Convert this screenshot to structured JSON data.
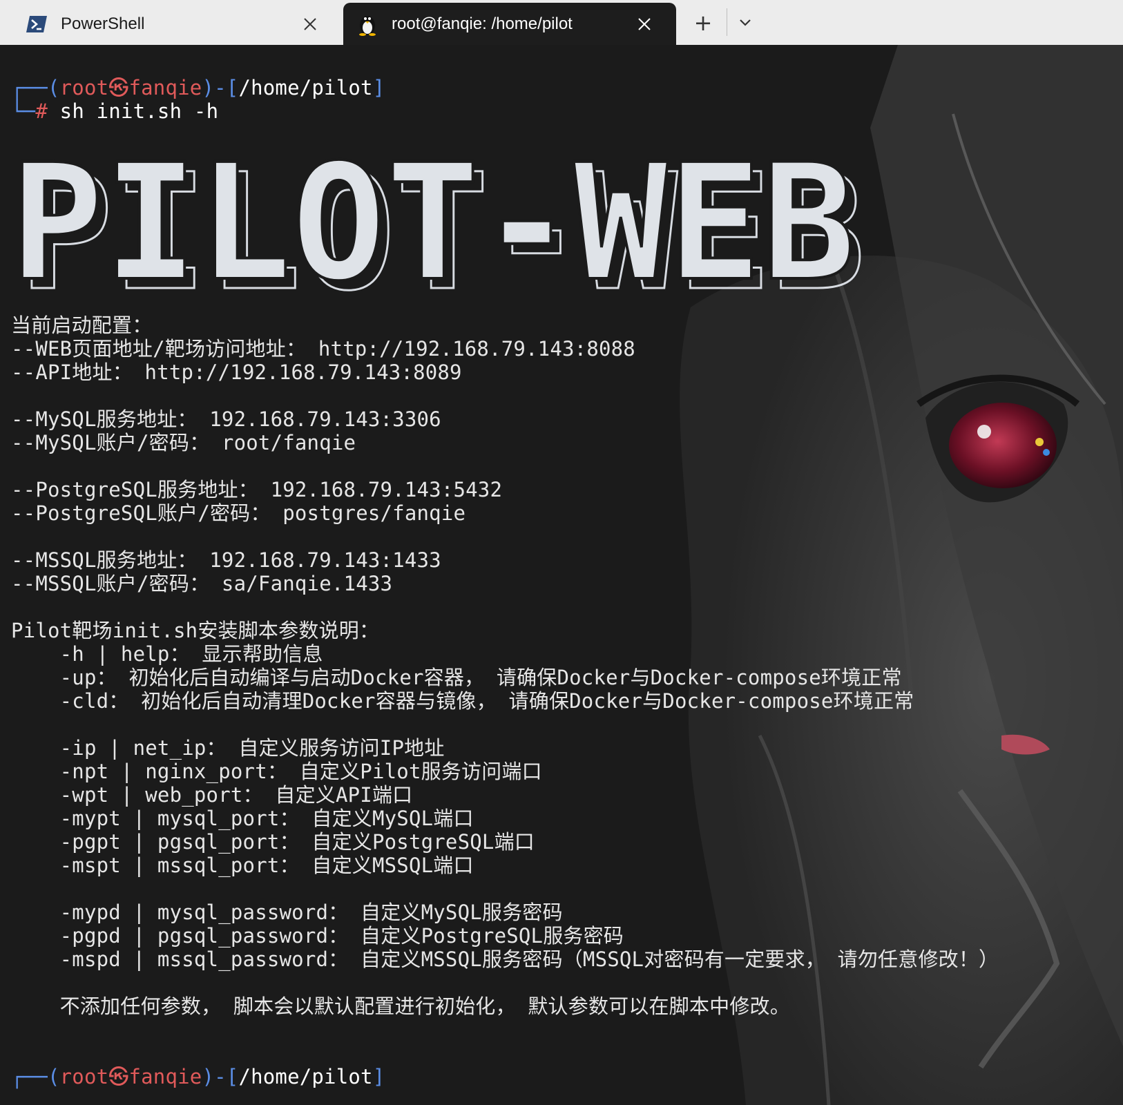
{
  "tabs": [
    {
      "label": "PowerShell",
      "icon": "powershell-icon",
      "active": false
    },
    {
      "label": "root@fanqie: /home/pilot",
      "icon": "linux-penguin-icon",
      "active": true
    }
  ],
  "tabbar": {
    "new_tab_label": "+",
    "dropdown_icon": "chevron-down-icon"
  },
  "prompt": {
    "open": "┌──(",
    "user": "root",
    "at_symbol": "㉿",
    "host": "fanqie",
    "mid": ")-[",
    "path": "/home/pilot",
    "close": "]",
    "hash_prefix": "└─",
    "hash": "#",
    "command": " sh init.sh -h"
  },
  "banner_text": "PILOT-WEB",
  "output": {
    "config_header": "当前启动配置：",
    "web_url": "--WEB页面地址/靶场访问地址： http://192.168.79.143:8088",
    "api_url": "--API地址： http://192.168.79.143:8089",
    "mysql_addr": "--MySQL服务地址： 192.168.79.143:3306",
    "mysql_account": "--MySQL账户/密码： root/fanqie",
    "pg_addr": "--PostgreSQL服务地址： 192.168.79.143:5432",
    "pg_account": "--PostgreSQL账户/密码： postgres/fanqie",
    "mssql_addr": "--MSSQL服务地址： 192.168.79.143:1433",
    "mssql_account": "--MSSQL账户/密码： sa/Fanqie.1433",
    "params_header": "Pilot靶场init.sh安装脚本参数说明：",
    "opt_h": "    -h | help： 显示帮助信息",
    "opt_up": "    -up： 初始化后自动编译与启动Docker容器， 请确保Docker与Docker-compose环境正常",
    "opt_cld": "    -cld： 初始化后自动清理Docker容器与镜像， 请确保Docker与Docker-compose环境正常",
    "opt_ip": "    -ip | net_ip： 自定义服务访问IP地址",
    "opt_npt": "    -npt | nginx_port： 自定义Pilot服务访问端口",
    "opt_wpt": "    -wpt | web_port： 自定义API端口",
    "opt_mypt": "    -mypt | mysql_port： 自定义MySQL端口",
    "opt_pgpt": "    -pgpt | pgsql_port： 自定义PostgreSQL端口",
    "opt_mspt": "    -mspt | mssql_port： 自定义MSSQL端口",
    "opt_mypd": "    -mypd | mysql_password： 自定义MySQL服务密码",
    "opt_pgpd": "    -pgpd | pgsql_password： 自定义PostgreSQL服务密码",
    "opt_mspd": "    -mspd | mssql_password： 自定义MSSQL服务密码（MSSQL对密码有一定要求， 请勿任意修改！）",
    "footer_note": "    不添加任何参数， 脚本会以默认配置进行初始化， 默认参数可以在脚本中修改。"
  },
  "colors": {
    "prompt_frame": "#5b8ee6",
    "prompt_user": "#e05a5a",
    "background": "#1b1b1b",
    "text": "#e6e6e6",
    "tabbar": "#ececec"
  }
}
